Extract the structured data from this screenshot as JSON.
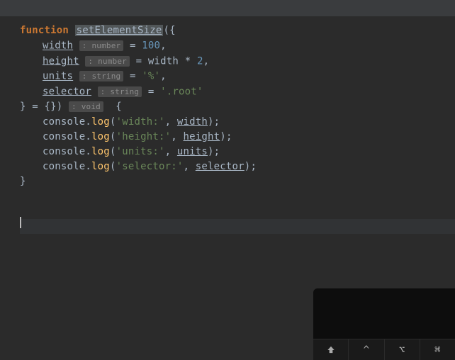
{
  "code": {
    "kw_function": "function",
    "fn_name": "setElementSize",
    "open": "({",
    "p_width": "width",
    "hint_number": ": number",
    "eq": " = ",
    "val_100": "100",
    "comma": ",",
    "p_height": "height",
    "ref_width": "width",
    "star": " * ",
    "val_2": "2",
    "p_units": "units",
    "hint_string": ": string",
    "val_pct": "'%'",
    "p_selector": "selector",
    "val_root": "'.root'",
    "dest_close_open": "} = {})",
    "hint_void": ": void",
    "body_open": "  {",
    "console": "console",
    "dot": ".",
    "log": "log",
    "lp": "(",
    "rp": ")",
    "semi": ";",
    "str_width": "'width:'",
    "str_height": "'height:'",
    "str_units": "'units:'",
    "str_selector": "'selector:'",
    "comma_sp": ", ",
    "ref_height": "height",
    "ref_units": "units",
    "ref_selector": "selector",
    "body_close": "}"
  },
  "toolbar": {
    "shift": "⇧",
    "ctrl": "^",
    "alt": "⌥",
    "cmd": "⌘"
  }
}
